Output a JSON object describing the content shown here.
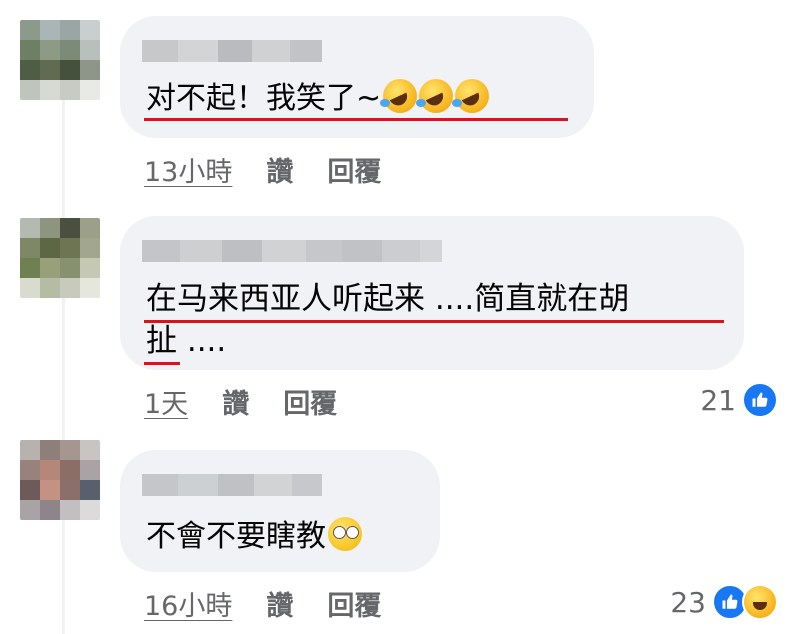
{
  "comments": [
    {
      "text_line1": "对不起！我笑了~",
      "text_line2": "",
      "emojis": [
        "rolling-on-floor-laughing",
        "rolling-on-floor-laughing",
        "rolling-on-floor-laughing"
      ],
      "time": "13小時",
      "like_label": "讚",
      "reply_label": "回覆",
      "reaction_count": "",
      "reactions": []
    },
    {
      "text_line1": "在马来西亚人听起来 ....简直就在胡",
      "text_line2": "扯 ....",
      "emojis": [],
      "time": "1天",
      "like_label": "讚",
      "reply_label": "回覆",
      "reaction_count": "21",
      "reactions": [
        "like"
      ]
    },
    {
      "text_line1": "不會不要瞎教",
      "text_line2": "",
      "emojis": [
        "face-with-rolling-eyes"
      ],
      "time": "16小時",
      "like_label": "讚",
      "reply_label": "回覆",
      "reaction_count": "23",
      "reactions": [
        "like",
        "haha"
      ]
    }
  ],
  "colors": {
    "bubble": "#f0f2f5",
    "underline": "#e0101a",
    "like_blue": "#1877f2",
    "meta_text": "#65676b"
  }
}
